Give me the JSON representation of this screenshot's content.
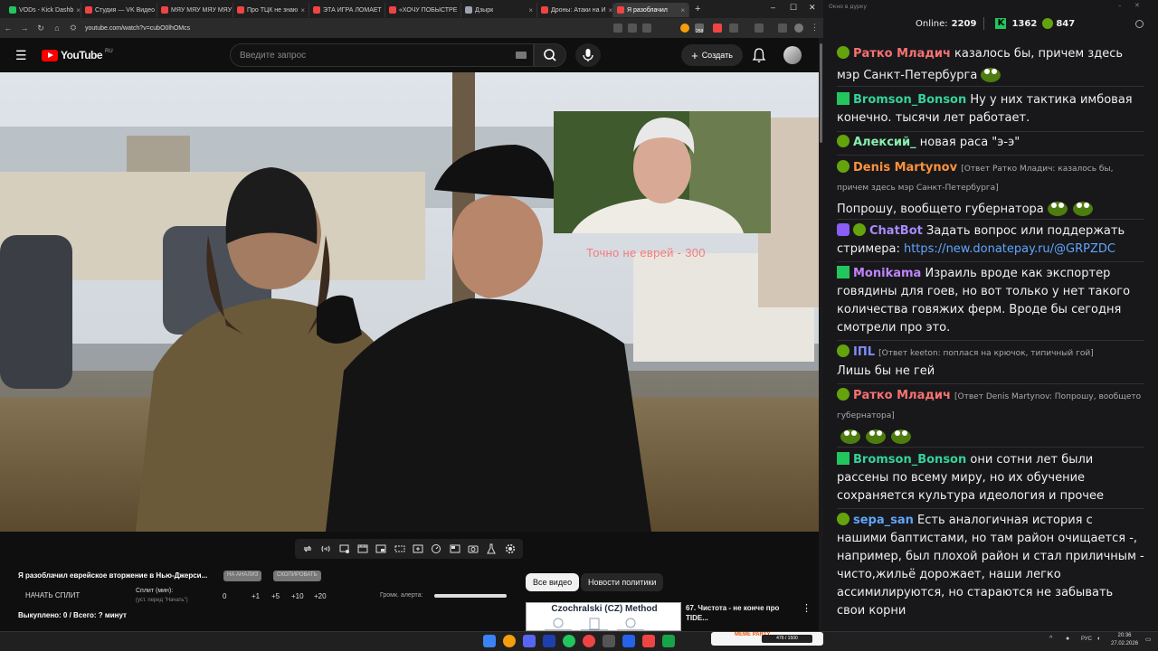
{
  "browser": {
    "tabs": [
      {
        "label": "VODs - Kick Dashb",
        "color": "#22c55e"
      },
      {
        "label": "Студия — VK Видео",
        "color": "#ef4444"
      },
      {
        "label": "МЯУ МЯУ МЯУ МЯУ",
        "color": "#ef4444"
      },
      {
        "label": "Про ТЦК не знаю",
        "color": "#ef4444"
      },
      {
        "label": "ЭТА ИГРА ЛОМАЕТ",
        "color": "#ef4444"
      },
      {
        "label": "«ХОЧУ ПОБЫСТРЕ",
        "color": "#ef4444"
      },
      {
        "label": "Дзырк",
        "color": "#9ca3af"
      },
      {
        "label": "Дроны: Атаки на И",
        "color": "#ef4444"
      },
      {
        "label": "Я разоблачил",
        "color": "#ef4444",
        "active": true
      }
    ],
    "new_tab": "+",
    "url": "youtube.com/watch?v=cubO0lhOMcs",
    "download_badge": "258"
  },
  "youtube": {
    "logo": "YouTube",
    "region": "RU",
    "search_placeholder": "Введите запрос",
    "create_label": "Создать",
    "video_overlay_text": "Точно не еврей  - 300",
    "video_title": "Я разоблачил еврейское вторжение в Нью-Джерси...",
    "chips": [
      "НА АНАЛИЗ",
      "СКОПИРОВАТЬ"
    ],
    "split_button": "НАЧАТЬ СПЛИТ",
    "split_label": "Сплит (мин):",
    "split_hint": "(уст. перед \"Начать\")",
    "split_values": [
      "0",
      "+1",
      "+5",
      "+10",
      "+20"
    ],
    "alert_volume_label": "Громк. алерта:",
    "alert_volume_level": 100,
    "bought_text": "Выкуплено: 0 / Всего: ? минут",
    "filter_all": "Все видео",
    "filter_policy": "Новости политики",
    "rec_thumb_title": "Czochralski (CZ) Method",
    "rec_video_title": "67. Чистота - не конче про TIDE..."
  },
  "chat": {
    "window_title": "Окно в дурку",
    "online_label": "Online:",
    "online_count": "2209",
    "kick_count": "1362",
    "pepe_count": "847",
    "messages": [
      {
        "nick": "Ратко Младич",
        "color": "#f87171",
        "badge": "pepe",
        "text": "казалось бы, причем здесь мэр Санкт-Петербурга",
        "emote": 1
      },
      {
        "nick": "Bromson_Bonson",
        "color": "#34d399",
        "badge": "kick",
        "text": "Ну у них тактика имбовая конечно. тысячи лет работает."
      },
      {
        "nick": "Алексий_",
        "color": "#86efac",
        "badge": "pepe",
        "text": "новая раса \"э-э\""
      },
      {
        "nick": "Denis Martynov",
        "color": "#fb923c",
        "badge": "pepe",
        "reply": "[Ответ Ратко Младич: казалось бы, причем здесь мэр Санкт-Петербурга]",
        "text": "Попрошу, вообщето губернатора",
        "emote": 2
      },
      {
        "nick": "ChatBot",
        "color": "#a78bfa",
        "badge": "bot",
        "text": "Задать вопрос или поддержать стримера:",
        "link": "https://new.donatepay.ru/@GRPZDC"
      },
      {
        "nick": "Monikama",
        "color": "#c084fc",
        "badge": "kick",
        "text": "Израиль вроде как экспортер говядины для гоев, но вот только у нет такого количества говяжих ферм. Вроде бы сегодня смотрели про это."
      },
      {
        "nick": "IПL",
        "color": "#818cf8",
        "badge": "pepe",
        "reply": "[Ответ keeton: поплася на крючок, типичный гой]",
        "text": "Лишь бы не гей"
      },
      {
        "nick": "Ратко Младич",
        "color": "#f87171",
        "badge": "pepe",
        "reply": "[Ответ Denis Martynov: Попрошу, вообщето губернатора]",
        "text": "",
        "emote": 3
      },
      {
        "nick": "Bromson_Bonson",
        "color": "#34d399",
        "badge": "kick",
        "text": "они сотни лет были рассены по всему миру, но их обучение сохраняется культура идеология и прочее"
      },
      {
        "nick": "sepa_san",
        "color": "#60a5fa",
        "badge": "pepe",
        "text": "Есть аналогичная история с нашими баптистами, но там район очищается -, например, был плохой район и стал приличным - чисто,жильё дорожает, наши легко ассимилируются, но стараются не забывать свои корни"
      }
    ]
  },
  "taskbar": {
    "widget_text": "MEME PARTY",
    "widget_counter": "476 / 1500",
    "lang": "РУС",
    "time": "20:36",
    "date": "27.02.2026"
  }
}
